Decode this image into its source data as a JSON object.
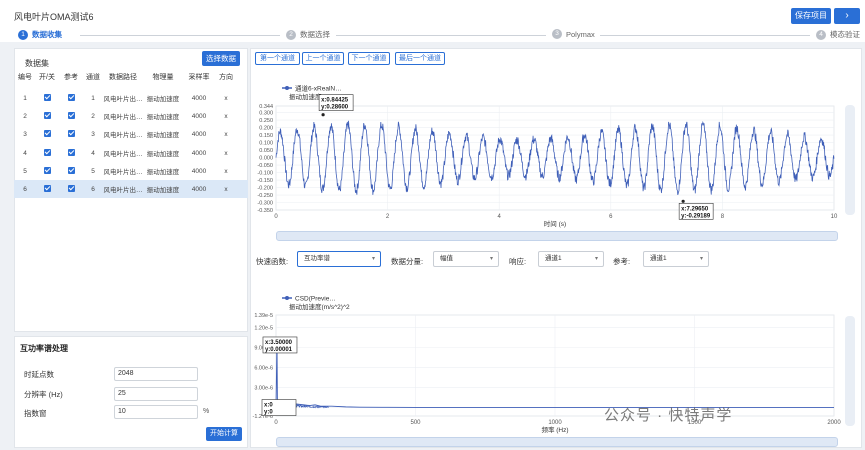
{
  "app": {
    "title": "风电叶片OMA测试6"
  },
  "toolbar": {
    "save_label": "保存项目",
    "next_label": "›"
  },
  "steps": [
    {
      "num": "1",
      "label": "数据收集"
    },
    {
      "num": "2",
      "label": "数据选择"
    },
    {
      "num": "3",
      "label": "Polymax"
    },
    {
      "num": "4",
      "label": "模态验证"
    }
  ],
  "dataset": {
    "title": "数据集",
    "select_button": "选择数据",
    "headers": [
      "编号",
      "开/关",
      "参考",
      "通道",
      "数据路径",
      "物理量",
      "采样率",
      "方向"
    ],
    "rows": [
      {
        "id": "1",
        "channel": "1",
        "path": "风电叶片出…",
        "quantity": "振动加速度",
        "rate": "4000",
        "dir": "x"
      },
      {
        "id": "2",
        "channel": "2",
        "path": "风电叶片出…",
        "quantity": "振动加速度",
        "rate": "4000",
        "dir": "x"
      },
      {
        "id": "3",
        "channel": "3",
        "path": "风电叶片出…",
        "quantity": "振动加速度",
        "rate": "4000",
        "dir": "x"
      },
      {
        "id": "4",
        "channel": "4",
        "path": "风电叶片出…",
        "quantity": "振动加速度",
        "rate": "4000",
        "dir": "x"
      },
      {
        "id": "5",
        "channel": "5",
        "path": "风电叶片出…",
        "quantity": "振动加速度",
        "rate": "4000",
        "dir": "x"
      },
      {
        "id": "6",
        "channel": "6",
        "path": "风电叶片出…",
        "quantity": "振动加速度",
        "rate": "4000",
        "dir": "x"
      }
    ],
    "selected_row": 6
  },
  "psd": {
    "title": "互功率谱处理",
    "fields": [
      {
        "label": "时延点数",
        "value": "2048",
        "unit": ""
      },
      {
        "label": "分辨率 (Hz)",
        "value": "25",
        "unit": ""
      },
      {
        "label": "指数窗",
        "value": "10",
        "unit": "%"
      }
    ],
    "start_button": "开始计算"
  },
  "channel_nav": [
    "第一个通道",
    "上一个通道",
    "下一个通道",
    "最后一个通道"
  ],
  "quick": {
    "func_label": "快速函数:",
    "func_value": "互功率谱",
    "component_label": "数据分量:",
    "component_value": "幅值",
    "response_label": "响应:",
    "response_value": "通道1",
    "reference_label": "参考:",
    "reference_value": "通道1"
  },
  "chart_data": [
    {
      "type": "line",
      "series": [
        {
          "name": "通道6-xRealN…",
          "color": "#3f5fb8"
        }
      ],
      "ylabel": "振动加速度(m/s^2)",
      "xlabel": "时间 (s)",
      "xlim": [
        0,
        10
      ],
      "ylim": [
        -0.35,
        0.344
      ],
      "x_ticks": [
        "0",
        "2",
        "4",
        "6",
        "8",
        "10"
      ],
      "y_ticks": [
        "0.344",
        "0.300",
        "0.250",
        "0.200",
        "0.150",
        "0.100",
        "0.050",
        "0.000",
        "-0.050",
        "-0.100",
        "-0.150",
        "-0.200",
        "-0.250",
        "-0.300",
        "-0.350"
      ],
      "signal": {
        "dominant_freq_hz": 3.3,
        "amplitude": 0.2,
        "noise": 0.035
      },
      "markers": [
        {
          "x_text": "x:0.84425",
          "y_text": "y:0.28600",
          "x": 0.84425,
          "y": 0.286
        },
        {
          "x_text": "x:7.29650",
          "y_text": "y:-0.29189",
          "x": 7.2965,
          "y": -0.29189
        }
      ]
    },
    {
      "type": "line",
      "series": [
        {
          "name": "CSD(Previe…",
          "color": "#3f5fb8"
        }
      ],
      "ylabel": "振动加速度(m/s^2)^2",
      "xlabel": "频率 (Hz)",
      "xlim": [
        0,
        2000
      ],
      "ylim": [
        -1.27e-06,
        1.39e-05
      ],
      "x_ticks": [
        "0",
        "500",
        "1000",
        "1500",
        "2000"
      ],
      "y_ticks": [
        "1.39e-5",
        "1.20e-5",
        "9.00e-6",
        "6.00e-6",
        "3.00e-6",
        "0.00",
        "-1.27e-6"
      ],
      "x": [
        0,
        3.5,
        5,
        10,
        20,
        40,
        60,
        80,
        100,
        120,
        140,
        160,
        200,
        250,
        300,
        400,
        500,
        700,
        1000,
        1500,
        2000
      ],
      "y": [
        0,
        1e-05,
        1.3e-06,
        8e-07,
        5e-07,
        4e-07,
        6e-07,
        5e-07,
        4e-07,
        3e-07,
        4e-07,
        2e-07,
        2e-07,
        1e-07,
        5e-08,
        3e-08,
        2e-08,
        1e-08,
        1e-08,
        1e-08,
        1e-08
      ],
      "markers": [
        {
          "x_text": "x:3.50000",
          "y_text": "y:0.00001",
          "x": 3.5,
          "y": 1e-05
        },
        {
          "x_text": "x:0",
          "y_text": "y:0",
          "x": 0,
          "y": 0
        }
      ]
    }
  ],
  "watermark": "公众号 · 快特声学"
}
